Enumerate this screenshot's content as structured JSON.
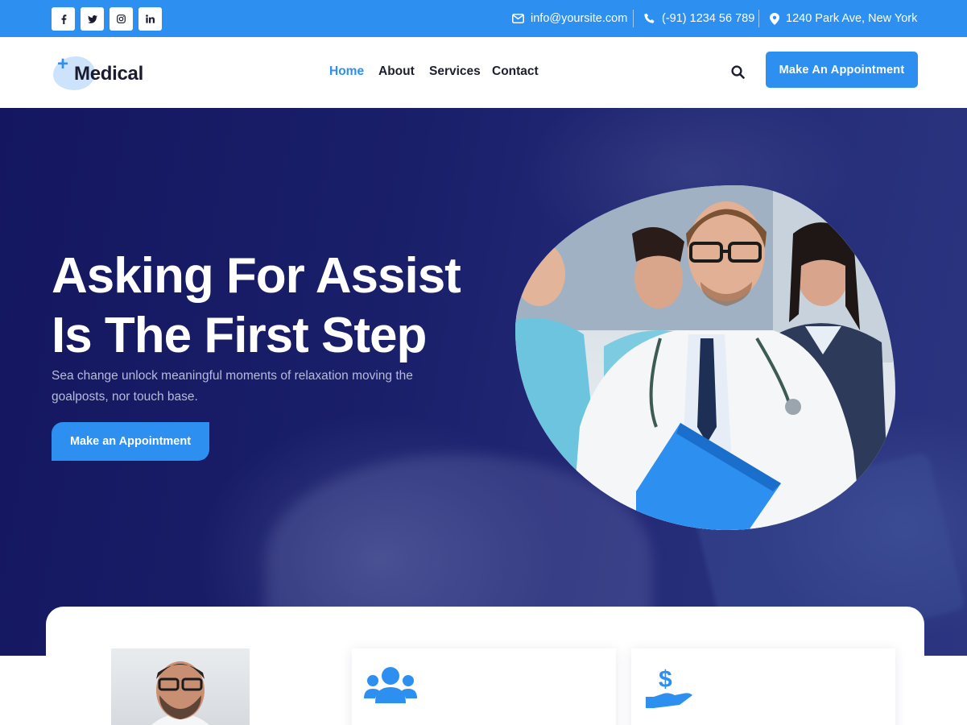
{
  "topbar": {
    "social": [
      {
        "icon": "facebook-icon",
        "glyph": "f"
      },
      {
        "icon": "twitter-icon",
        "glyph": "t"
      },
      {
        "icon": "instagram-icon",
        "glyph": "ig"
      },
      {
        "icon": "linkedin-icon",
        "glyph": "in"
      }
    ],
    "email": "info@yoursite.com",
    "phone": "(-91) 1234 56 789",
    "address": "1240 Park Ave, New York"
  },
  "header": {
    "logo_text": "Medical",
    "nav": [
      "Home",
      "About",
      "Services",
      "Contact"
    ],
    "active_nav": "Home",
    "cta_label": "Make An Appointment"
  },
  "hero": {
    "title_line1": "Asking For Assist",
    "title_line2": "Is The First Step",
    "subtitle": "Sea change unlock meaningful moments of relaxation moving the goalposts, nor touch base.",
    "cta_label": "Make an Appointment"
  },
  "features": {
    "cards": [
      {
        "icon": "team-icon"
      },
      {
        "icon": "dollar-hand-icon"
      }
    ]
  },
  "colors": {
    "accent": "#2d8ff0",
    "hero_dark": "#14175f",
    "text_dark": "#1d1f2e"
  }
}
